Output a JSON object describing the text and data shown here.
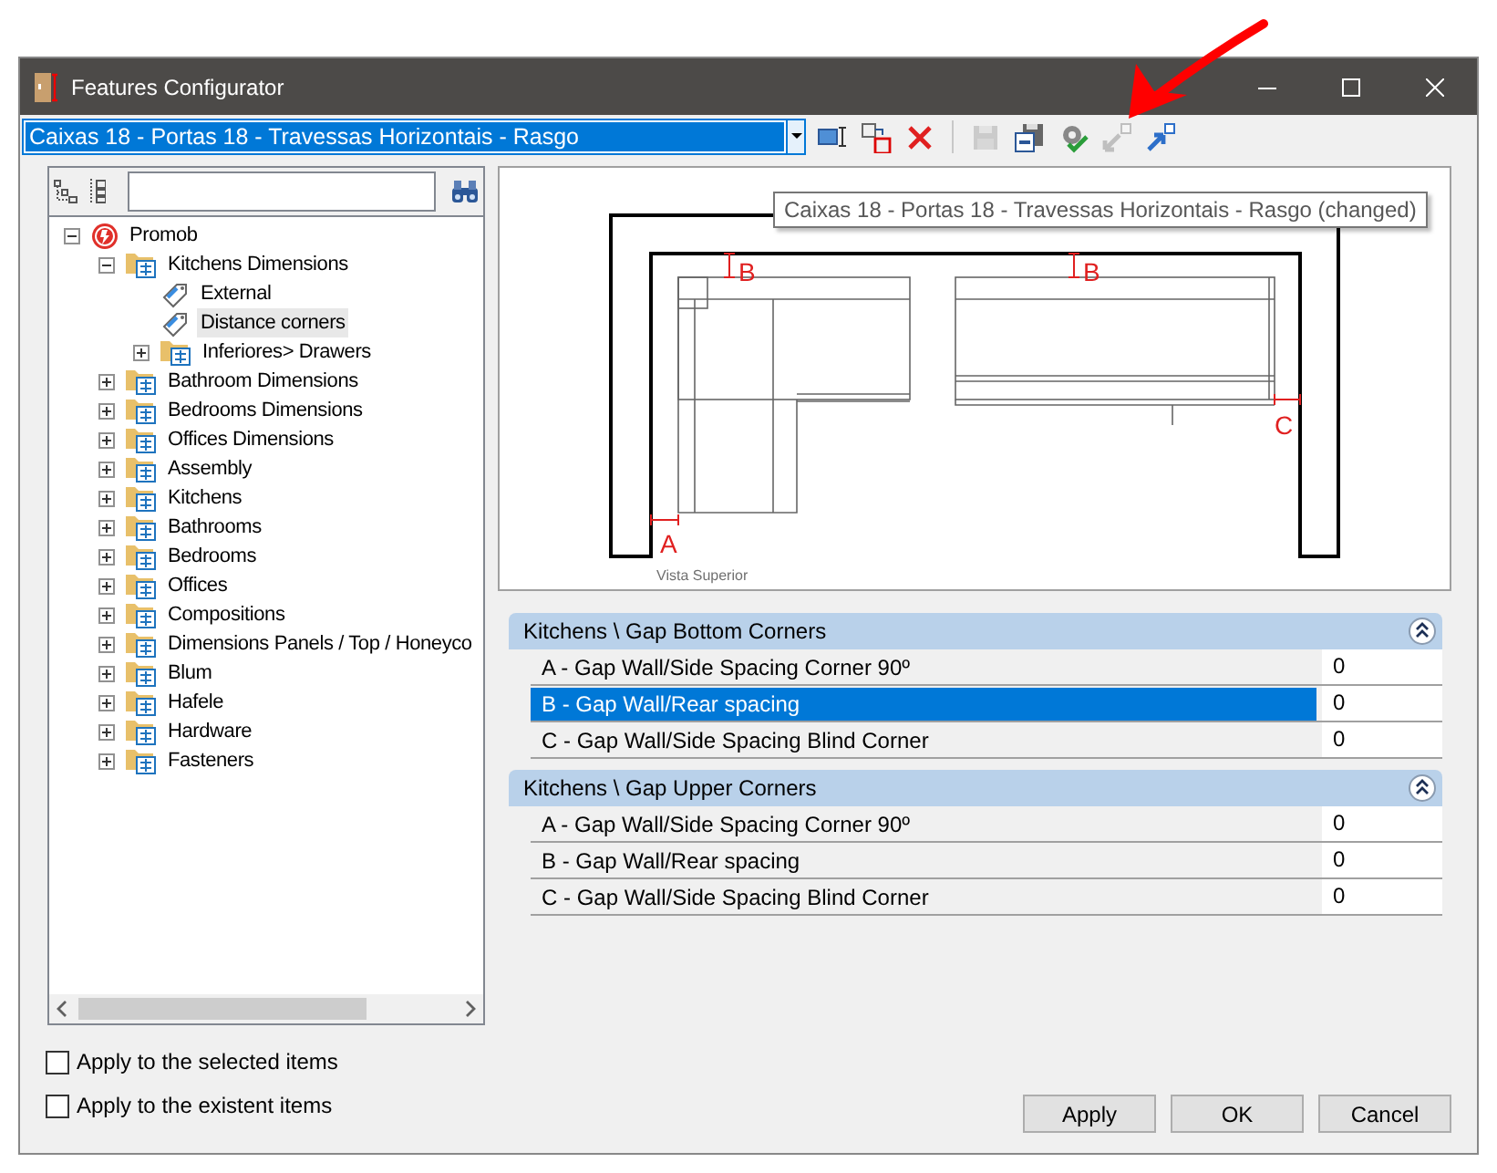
{
  "window": {
    "title": "Features Configurator"
  },
  "toolbar": {
    "configuration": "Caixas 18 - Portas 18 - Travessas Horizontais - Rasgo",
    "buttons": [
      {
        "kind": "rename",
        "disabled": false
      },
      {
        "kind": "move",
        "disabled": false
      },
      {
        "kind": "delete",
        "disabled": false
      },
      {
        "kind": "separator"
      },
      {
        "kind": "save",
        "disabled": true
      },
      {
        "kind": "saveas",
        "disabled": false
      },
      {
        "kind": "verify",
        "disabled": false
      },
      {
        "kind": "import",
        "disabled": true
      },
      {
        "kind": "export",
        "disabled": false
      }
    ]
  },
  "tree": {
    "nodes": [
      {
        "label": "Promob",
        "kind": "root",
        "expanded": true,
        "selected": false,
        "children": [
          {
            "label": "Kitchens Dimensions",
            "kind": "folder",
            "expanded": true,
            "selected": false,
            "children": [
              {
                "label": "External",
                "kind": "leaf",
                "selected": false
              },
              {
                "label": "Distance corners",
                "kind": "leaf",
                "selected": true
              },
              {
                "label": "Inferiores> Drawers",
                "kind": "folder",
                "expanded": false,
                "selected": false
              }
            ]
          },
          {
            "label": "Bathroom Dimensions",
            "kind": "folder",
            "expanded": false,
            "selected": false
          },
          {
            "label": "Bedrooms Dimensions",
            "kind": "folder",
            "expanded": false,
            "selected": false
          },
          {
            "label": "Offices Dimensions",
            "kind": "folder",
            "expanded": false,
            "selected": false
          },
          {
            "label": "Assembly",
            "kind": "folder",
            "expanded": false,
            "selected": false
          },
          {
            "label": "Kitchens",
            "kind": "folder",
            "expanded": false,
            "selected": false
          },
          {
            "label": "Bathrooms",
            "kind": "folder",
            "expanded": false,
            "selected": false
          },
          {
            "label": "Bedrooms",
            "kind": "folder",
            "expanded": false,
            "selected": false
          },
          {
            "label": "Offices",
            "kind": "folder",
            "expanded": false,
            "selected": false
          },
          {
            "label": "Compositions",
            "kind": "folder",
            "expanded": false,
            "selected": false
          },
          {
            "label": "Dimensions Panels / Top / Honeyco",
            "kind": "folder",
            "expanded": false,
            "selected": false
          },
          {
            "label": "Blum",
            "kind": "folder",
            "expanded": false,
            "selected": false
          },
          {
            "label": "Hafele",
            "kind": "folder",
            "expanded": false,
            "selected": false
          },
          {
            "label": "Hardware",
            "kind": "folder",
            "expanded": false,
            "selected": false
          },
          {
            "label": "Fasteners",
            "kind": "folder",
            "expanded": false,
            "selected": false
          }
        ]
      }
    ]
  },
  "preview": {
    "tooltip": "Caixas 18 - Portas 18 - Travessas Horizontais - Rasgo (changed)",
    "labels": [
      "B",
      "B",
      "C",
      "A"
    ],
    "caption": "Vista Superior"
  },
  "groups": [
    {
      "title": "Kitchens \\ Gap Bottom Corners",
      "expanded": true,
      "rows": [
        {
          "label": "A - Gap Wall/Side Spacing Corner 90º",
          "value": "0",
          "selected": false
        },
        {
          "label": "B - Gap Wall/Rear spacing",
          "value": "0",
          "selected": true
        },
        {
          "label": "C - Gap Wall/Side Spacing Blind Corner",
          "value": "0",
          "selected": false
        }
      ]
    },
    {
      "title": "Kitchens \\ Gap Upper Corners",
      "expanded": true,
      "rows": [
        {
          "label": "A - Gap Wall/Side Spacing Corner 90º",
          "value": "0",
          "selected": false
        },
        {
          "label": "B - Gap Wall/Rear spacing",
          "value": "0",
          "selected": false
        },
        {
          "label": "C - Gap Wall/Side Spacing Blind Corner",
          "value": "0",
          "selected": false
        }
      ]
    }
  ],
  "options": [
    {
      "label": "Apply to the selected items",
      "checked": false
    },
    {
      "label": "Apply to the existent items",
      "checked": false
    }
  ],
  "buttons": [
    "Apply",
    "OK",
    "Cancel"
  ]
}
